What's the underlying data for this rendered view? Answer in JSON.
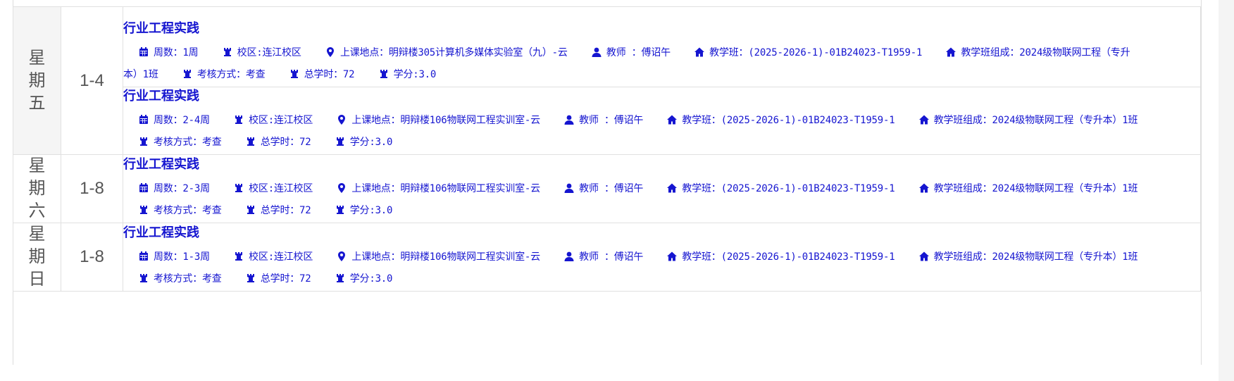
{
  "colors": {
    "link": "#1515d0",
    "border": "#e0e0e0",
    "day_shade": "#f5f5f5"
  },
  "rows": [
    {
      "day": [
        "星",
        "期",
        "五"
      ],
      "period": "1-4",
      "courses": [
        {
          "title": "行业工程实践",
          "weeks": "周数：1周",
          "campus": "校区:连江校区",
          "location": "上课地点：明辩楼305计算机多媒体实验室（九）-云",
          "teacher": "教师 ：傅诏午",
          "class": "教学班：(2025-2026-1)-01B24023-T1959-1",
          "class_comp_a": "教学班组成：2024级物联网工程（专升",
          "class_comp_b": "本）1班",
          "exam": "考核方式：考查",
          "hours": "总学时：72",
          "credits": "学分:3.0"
        },
        {
          "title": "行业工程实践",
          "weeks": "周数：2-4周",
          "campus": "校区:连江校区",
          "location": "上课地点：明辩楼106物联网工程实训室-云",
          "teacher": "教师 ：傅诏午",
          "class": "教学班：(2025-2026-1)-01B24023-T1959-1",
          "class_comp": "教学班组成：2024级物联网工程（专升本）1班",
          "exam": "考核方式：考查",
          "hours": "总学时：72",
          "credits": "学分:3.0"
        }
      ]
    },
    {
      "day": [
        "星",
        "期",
        "六"
      ],
      "period": "1-8",
      "courses": [
        {
          "title": "行业工程实践",
          "weeks": "周数：2-3周",
          "campus": "校区:连江校区",
          "location": "上课地点：明辩楼106物联网工程实训室-云",
          "teacher": "教师 ：傅诏午",
          "class": "教学班：(2025-2026-1)-01B24023-T1959-1",
          "class_comp": "教学班组成：2024级物联网工程（专升本）1班",
          "exam": "考核方式：考查",
          "hours": "总学时：72",
          "credits": "学分:3.0"
        }
      ]
    },
    {
      "day": [
        "星",
        "期",
        "日"
      ],
      "period": "1-8",
      "courses": [
        {
          "title": "行业工程实践",
          "weeks": "周数：1-3周",
          "campus": "校区:连江校区",
          "location": "上课地点：明辩楼106物联网工程实训室-云",
          "teacher": "教师 ：傅诏午",
          "class": "教学班：(2025-2026-1)-01B24023-T1959-1",
          "class_comp": "教学班组成：2024级物联网工程（专升本）1班",
          "exam": "考核方式：考查",
          "hours": "总学时：72",
          "credits": "学分:3.0"
        }
      ]
    }
  ],
  "icons": {
    "weeks": "calendar-icon",
    "campus": "tower-icon",
    "location": "map-marker-icon",
    "teacher": "user-icon",
    "class": "home-icon",
    "class_comp": "home-icon",
    "exam": "tower-icon",
    "hours": "tower-icon",
    "credits": "tower-icon"
  }
}
